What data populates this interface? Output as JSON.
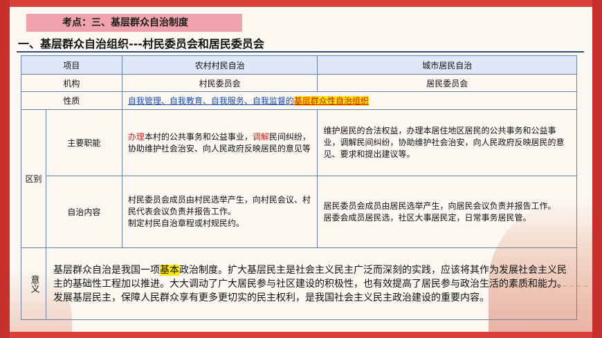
{
  "topic_label": "考点：三、基层群众自治制度",
  "heading": "一、基层群众自治组织---村民委员会和居民委员会",
  "table": {
    "headers": [
      "项目",
      "农村村民自治",
      "城市居民自治"
    ],
    "org": {
      "label": "机构",
      "rural": "村民委员会",
      "urban": "居民委员会"
    },
    "nature": {
      "label": "性质",
      "link_text": "自我管理、自我教育、自我服务、自我监督的",
      "highlight": "基层群众性自治组织"
    },
    "diff_label": "区别",
    "functions": {
      "label": "主要职能",
      "rural_red1": "办理",
      "rural_mid": "本村的公共事务和公益事业，",
      "rural_red2": "调解",
      "rural_rest": "民间纠纷，协助维护社会治安、向人民政府反映居民的意见等",
      "urban": "维护居民的合法权益，办理本居住地区居民的公共事务和公益事业，调解民间纠纷，协助维护社会治安，向人民政府反映居民的意见、要求和提出建议等。"
    },
    "autonomy": {
      "label": "自治内容",
      "rural_line1": "村民委员会成员由村民选举产生，向村民会议、村民代表会议负责并报告工作。",
      "rural_line2": "制定村民自治章程或村规民约。",
      "urban_line1": "居民委员会成员由居民选举产生，向居民会议负责并报告工作。",
      "urban_line2": "居委会成员居民选，社区大事居民定，日常事务居民管。"
    },
    "meaning": {
      "label": "意义",
      "pre": "基层群众自治是我国一项",
      "hl": "基本",
      "post": "政治制度。扩大基层民主是社会主义民主广泛而深刻的实践，应该将其作为发展社会主义民主的基础性工程加以推进。大大调动了广大居民参与社区建设的积极性，也有效提高了居民参与政治生活的素质和能力。发展基层民主，保障人民群众享有更多更切实的民主权利，是我国社会主义民主政治建设的重要内容。"
    }
  }
}
